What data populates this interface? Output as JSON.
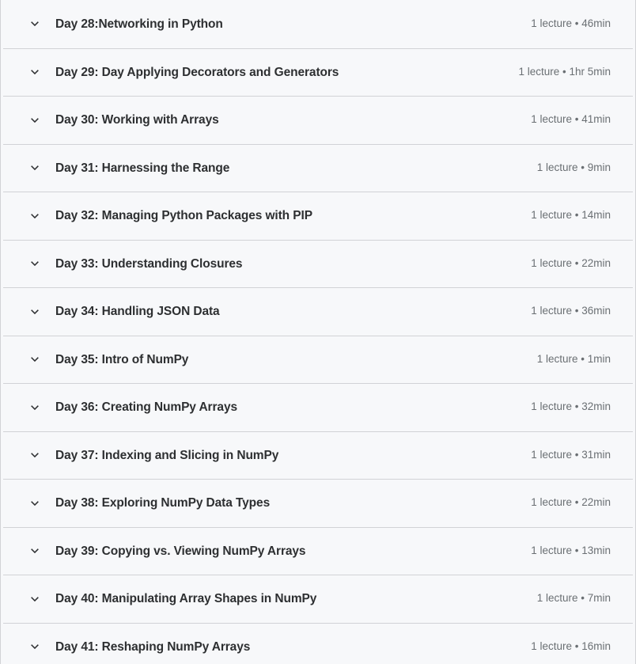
{
  "colors": {
    "row_background": "#f7f8fa",
    "divider": "#d1d2d6",
    "title_text": "#2d2f31",
    "meta_text": "#6a6f73",
    "chevron": "#2d2f31"
  },
  "icons": {
    "expand": "chevron-down-icon"
  },
  "curriculum": {
    "sections": [
      {
        "title": "Day 28:Networking in Python",
        "meta": "1 lecture • 46min",
        "lectures": "1 lecture",
        "duration": "46min"
      },
      {
        "title": "Day 29: Day Applying Decorators and Generators",
        "meta": "1 lecture • 1hr 5min",
        "lectures": "1 lecture",
        "duration": "1hr 5min"
      },
      {
        "title": "Day 30: Working with Arrays",
        "meta": "1 lecture • 41min",
        "lectures": "1 lecture",
        "duration": "41min"
      },
      {
        "title": "Day 31: Harnessing the Range",
        "meta": "1 lecture • 9min",
        "lectures": "1 lecture",
        "duration": "9min"
      },
      {
        "title": "Day 32: Managing Python Packages with PIP",
        "meta": "1 lecture • 14min",
        "lectures": "1 lecture",
        "duration": "14min"
      },
      {
        "title": "Day 33: Understanding Closures",
        "meta": "1 lecture • 22min",
        "lectures": "1 lecture",
        "duration": "22min"
      },
      {
        "title": "Day 34: Handling JSON Data",
        "meta": "1 lecture • 36min",
        "lectures": "1 lecture",
        "duration": "36min"
      },
      {
        "title": "Day 35: Intro of NumPy",
        "meta": "1 lecture • 1min",
        "lectures": "1 lecture",
        "duration": "1min"
      },
      {
        "title": "Day 36: Creating NumPy Arrays",
        "meta": "1 lecture • 32min",
        "lectures": "1 lecture",
        "duration": "32min"
      },
      {
        "title": "Day 37: Indexing and Slicing in NumPy",
        "meta": "1 lecture • 31min",
        "lectures": "1 lecture",
        "duration": "31min"
      },
      {
        "title": "Day 38: Exploring NumPy Data Types",
        "meta": "1 lecture • 22min",
        "lectures": "1 lecture",
        "duration": "22min"
      },
      {
        "title": "Day 39: Copying vs. Viewing NumPy Arrays",
        "meta": "1 lecture • 13min",
        "lectures": "1 lecture",
        "duration": "13min"
      },
      {
        "title": "Day 40: Manipulating Array Shapes in NumPy",
        "meta": "1 lecture • 7min",
        "lectures": "1 lecture",
        "duration": "7min"
      },
      {
        "title": "Day 41: Reshaping NumPy Arrays",
        "meta": "1 lecture • 16min",
        "lectures": "1 lecture",
        "duration": "16min"
      }
    ]
  }
}
